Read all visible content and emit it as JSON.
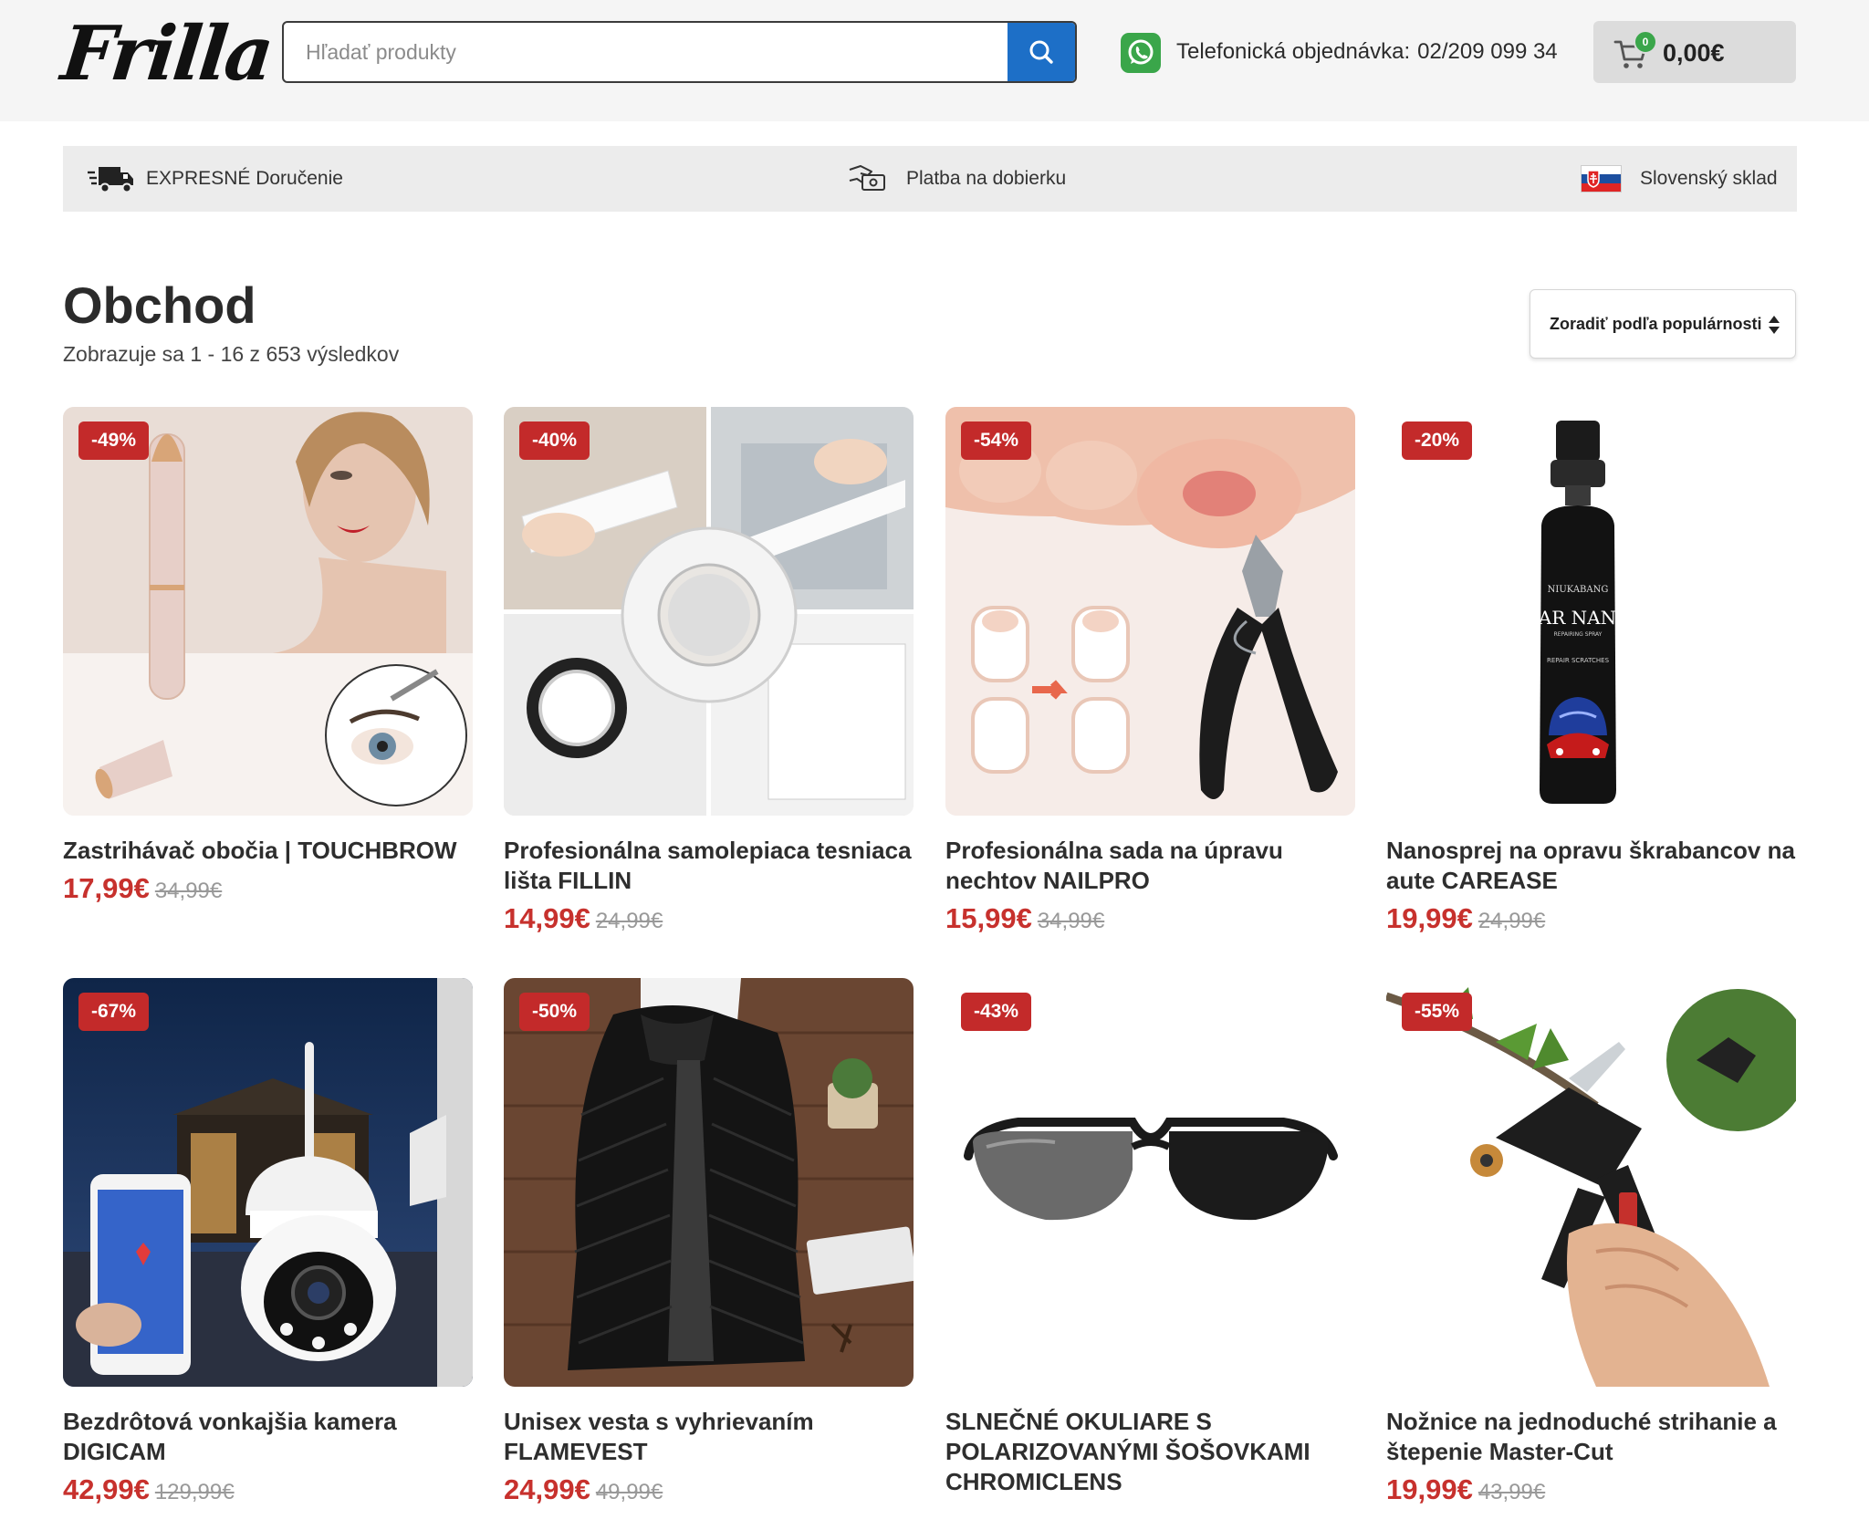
{
  "brand": {
    "logo_text": "Frilla"
  },
  "search": {
    "placeholder": "Hľadať produkty"
  },
  "contact": {
    "label": "Telefonická objednávka:",
    "phone": "02/209 099 34"
  },
  "cart": {
    "count": "0",
    "total": "0,00€"
  },
  "features": [
    {
      "icon": "delivery-truck-icon",
      "label": "EXPRESNÉ Doručenie"
    },
    {
      "icon": "hand-payment-icon",
      "label": "Platba na dobierku"
    },
    {
      "icon": "slovak-flag-icon",
      "label": "Slovenský sklad"
    }
  ],
  "shop": {
    "title": "Obchod",
    "result_count": "Zobrazuje sa 1 - 16 z 653 výsledkov",
    "sort_label": "Zoradiť podľa populárnosti"
  },
  "products": [
    {
      "name": "Zastrihávač obočia | TOUCHBROW",
      "discount": "-49%",
      "price": "17,99€",
      "old_price": "34,99€"
    },
    {
      "name": "Profesionálna samolepiaca tesniaca lišta FILLIN",
      "discount": "-40%",
      "price": "14,99€",
      "old_price": "24,99€"
    },
    {
      "name": "Profesionálna sada na úpravu nechtov NAILPRO",
      "discount": "-54%",
      "price": "15,99€",
      "old_price": "34,99€"
    },
    {
      "name": "Nanosprej na opravu škrabancov na aute CAREASE",
      "discount": "-20%",
      "price": "19,99€",
      "old_price": "24,99€",
      "image_text": {
        "brand": "NIUKABANG",
        "title": "CAR NANO",
        "sub": "REPAIRING SPRAY",
        "sub2": "REPAIR SCRATCHES"
      }
    },
    {
      "name": "Bezdrôtová vonkajšia kamera DIGICAM",
      "discount": "-67%",
      "price": "42,99€",
      "old_price": "129,99€"
    },
    {
      "name": "Unisex vesta s vyhrievaním FLAMEVEST",
      "discount": "-50%",
      "price": "24,99€",
      "old_price": "49,99€"
    },
    {
      "name": "SLNEČNÉ OKULIARE S POLARIZOVANÝMI ŠOŠOVKAMI CHROMICLENS",
      "discount": "-43%",
      "price": "",
      "old_price": ""
    },
    {
      "name": "Nožnice na jednoduché strihanie a štepenie Master-Cut",
      "discount": "-55%",
      "price": "19,99€",
      "old_price": "43,99€"
    }
  ],
  "colors": {
    "accent_blue": "#1d6fc7",
    "sale_red": "#c32a2a",
    "price_red": "#c7312d",
    "whatsapp_green": "#3aa64a"
  }
}
